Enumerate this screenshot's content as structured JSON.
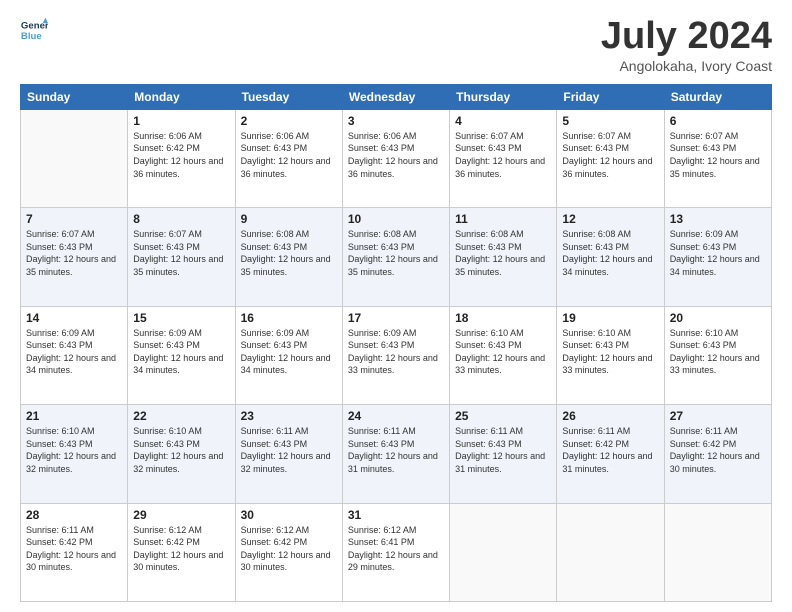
{
  "header": {
    "logo_line1": "General",
    "logo_line2": "Blue",
    "month": "July 2024",
    "location": "Angolokaha, Ivory Coast"
  },
  "weekdays": [
    "Sunday",
    "Monday",
    "Tuesday",
    "Wednesday",
    "Thursday",
    "Friday",
    "Saturday"
  ],
  "weeks": [
    [
      {
        "day": "",
        "sunrise": "",
        "sunset": "",
        "daylight": ""
      },
      {
        "day": "1",
        "sunrise": "Sunrise: 6:06 AM",
        "sunset": "Sunset: 6:42 PM",
        "daylight": "Daylight: 12 hours and 36 minutes."
      },
      {
        "day": "2",
        "sunrise": "Sunrise: 6:06 AM",
        "sunset": "Sunset: 6:43 PM",
        "daylight": "Daylight: 12 hours and 36 minutes."
      },
      {
        "day": "3",
        "sunrise": "Sunrise: 6:06 AM",
        "sunset": "Sunset: 6:43 PM",
        "daylight": "Daylight: 12 hours and 36 minutes."
      },
      {
        "day": "4",
        "sunrise": "Sunrise: 6:07 AM",
        "sunset": "Sunset: 6:43 PM",
        "daylight": "Daylight: 12 hours and 36 minutes."
      },
      {
        "day": "5",
        "sunrise": "Sunrise: 6:07 AM",
        "sunset": "Sunset: 6:43 PM",
        "daylight": "Daylight: 12 hours and 36 minutes."
      },
      {
        "day": "6",
        "sunrise": "Sunrise: 6:07 AM",
        "sunset": "Sunset: 6:43 PM",
        "daylight": "Daylight: 12 hours and 35 minutes."
      }
    ],
    [
      {
        "day": "7",
        "sunrise": "Sunrise: 6:07 AM",
        "sunset": "Sunset: 6:43 PM",
        "daylight": "Daylight: 12 hours and 35 minutes."
      },
      {
        "day": "8",
        "sunrise": "Sunrise: 6:07 AM",
        "sunset": "Sunset: 6:43 PM",
        "daylight": "Daylight: 12 hours and 35 minutes."
      },
      {
        "day": "9",
        "sunrise": "Sunrise: 6:08 AM",
        "sunset": "Sunset: 6:43 PM",
        "daylight": "Daylight: 12 hours and 35 minutes."
      },
      {
        "day": "10",
        "sunrise": "Sunrise: 6:08 AM",
        "sunset": "Sunset: 6:43 PM",
        "daylight": "Daylight: 12 hours and 35 minutes."
      },
      {
        "day": "11",
        "sunrise": "Sunrise: 6:08 AM",
        "sunset": "Sunset: 6:43 PM",
        "daylight": "Daylight: 12 hours and 35 minutes."
      },
      {
        "day": "12",
        "sunrise": "Sunrise: 6:08 AM",
        "sunset": "Sunset: 6:43 PM",
        "daylight": "Daylight: 12 hours and 34 minutes."
      },
      {
        "day": "13",
        "sunrise": "Sunrise: 6:09 AM",
        "sunset": "Sunset: 6:43 PM",
        "daylight": "Daylight: 12 hours and 34 minutes."
      }
    ],
    [
      {
        "day": "14",
        "sunrise": "Sunrise: 6:09 AM",
        "sunset": "Sunset: 6:43 PM",
        "daylight": "Daylight: 12 hours and 34 minutes."
      },
      {
        "day": "15",
        "sunrise": "Sunrise: 6:09 AM",
        "sunset": "Sunset: 6:43 PM",
        "daylight": "Daylight: 12 hours and 34 minutes."
      },
      {
        "day": "16",
        "sunrise": "Sunrise: 6:09 AM",
        "sunset": "Sunset: 6:43 PM",
        "daylight": "Daylight: 12 hours and 34 minutes."
      },
      {
        "day": "17",
        "sunrise": "Sunrise: 6:09 AM",
        "sunset": "Sunset: 6:43 PM",
        "daylight": "Daylight: 12 hours and 33 minutes."
      },
      {
        "day": "18",
        "sunrise": "Sunrise: 6:10 AM",
        "sunset": "Sunset: 6:43 PM",
        "daylight": "Daylight: 12 hours and 33 minutes."
      },
      {
        "day": "19",
        "sunrise": "Sunrise: 6:10 AM",
        "sunset": "Sunset: 6:43 PM",
        "daylight": "Daylight: 12 hours and 33 minutes."
      },
      {
        "day": "20",
        "sunrise": "Sunrise: 6:10 AM",
        "sunset": "Sunset: 6:43 PM",
        "daylight": "Daylight: 12 hours and 33 minutes."
      }
    ],
    [
      {
        "day": "21",
        "sunrise": "Sunrise: 6:10 AM",
        "sunset": "Sunset: 6:43 PM",
        "daylight": "Daylight: 12 hours and 32 minutes."
      },
      {
        "day": "22",
        "sunrise": "Sunrise: 6:10 AM",
        "sunset": "Sunset: 6:43 PM",
        "daylight": "Daylight: 12 hours and 32 minutes."
      },
      {
        "day": "23",
        "sunrise": "Sunrise: 6:11 AM",
        "sunset": "Sunset: 6:43 PM",
        "daylight": "Daylight: 12 hours and 32 minutes."
      },
      {
        "day": "24",
        "sunrise": "Sunrise: 6:11 AM",
        "sunset": "Sunset: 6:43 PM",
        "daylight": "Daylight: 12 hours and 31 minutes."
      },
      {
        "day": "25",
        "sunrise": "Sunrise: 6:11 AM",
        "sunset": "Sunset: 6:43 PM",
        "daylight": "Daylight: 12 hours and 31 minutes."
      },
      {
        "day": "26",
        "sunrise": "Sunrise: 6:11 AM",
        "sunset": "Sunset: 6:42 PM",
        "daylight": "Daylight: 12 hours and 31 minutes."
      },
      {
        "day": "27",
        "sunrise": "Sunrise: 6:11 AM",
        "sunset": "Sunset: 6:42 PM",
        "daylight": "Daylight: 12 hours and 30 minutes."
      }
    ],
    [
      {
        "day": "28",
        "sunrise": "Sunrise: 6:11 AM",
        "sunset": "Sunset: 6:42 PM",
        "daylight": "Daylight: 12 hours and 30 minutes."
      },
      {
        "day": "29",
        "sunrise": "Sunrise: 6:12 AM",
        "sunset": "Sunset: 6:42 PM",
        "daylight": "Daylight: 12 hours and 30 minutes."
      },
      {
        "day": "30",
        "sunrise": "Sunrise: 6:12 AM",
        "sunset": "Sunset: 6:42 PM",
        "daylight": "Daylight: 12 hours and 30 minutes."
      },
      {
        "day": "31",
        "sunrise": "Sunrise: 6:12 AM",
        "sunset": "Sunset: 6:41 PM",
        "daylight": "Daylight: 12 hours and 29 minutes."
      },
      {
        "day": "",
        "sunrise": "",
        "sunset": "",
        "daylight": ""
      },
      {
        "day": "",
        "sunrise": "",
        "sunset": "",
        "daylight": ""
      },
      {
        "day": "",
        "sunrise": "",
        "sunset": "",
        "daylight": ""
      }
    ]
  ]
}
